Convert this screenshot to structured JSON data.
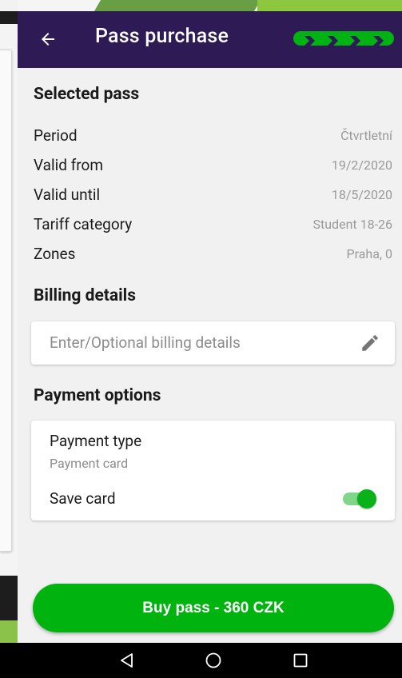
{
  "app_bar": {
    "title": "Pass purchase",
    "back_icon": "arrow-back-icon",
    "progress_steps": 5,
    "progress_completed": 5,
    "accent_color": "#00b312",
    "background_color": "#2e1b55"
  },
  "selected_pass": {
    "heading": "Selected pass",
    "rows": [
      {
        "label": "Period",
        "value": "Čtvrtletní"
      },
      {
        "label": "Valid from",
        "value": "19/2/2020"
      },
      {
        "label": "Valid until",
        "value": "18/5/2020"
      },
      {
        "label": "Tariff category",
        "value": "Student 18-26"
      },
      {
        "label": "Zones",
        "value": "Praha, 0"
      }
    ]
  },
  "billing": {
    "heading": "Billing details",
    "placeholder": "Enter/Optional billing details",
    "edit_icon": "pencil-icon"
  },
  "payment": {
    "heading": "Payment options",
    "type_label": "Payment type",
    "type_value": "Payment card",
    "save_card_label": "Save card",
    "save_card_enabled": true
  },
  "buy_button": {
    "label": "Buy pass - 360 CZK",
    "color": "#00b30f"
  },
  "system_nav": {
    "back_icon": "triangle-back-icon",
    "home_icon": "circle-home-icon",
    "recents_icon": "square-recents-icon"
  }
}
